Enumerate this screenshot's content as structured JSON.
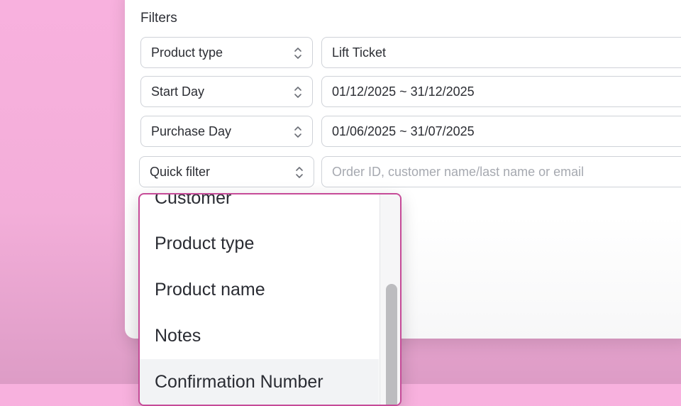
{
  "filters": {
    "title": "Filters",
    "rows": [
      {
        "select_label": "Product type",
        "value": "Lift Ticket",
        "placeholder": ""
      },
      {
        "select_label": "Start Day",
        "value": "01/12/2025 ~ 31/12/2025",
        "placeholder": ""
      },
      {
        "select_label": "Purchase Day",
        "value": "01/06/2025 ~ 31/07/2025",
        "placeholder": ""
      },
      {
        "select_label": "Quick filter",
        "value": "",
        "placeholder": "Order ID, customer name/last name or email"
      }
    ]
  },
  "dropdown": {
    "items": [
      "Customer",
      "Product type",
      "Product name",
      "Notes",
      "Confirmation Number"
    ],
    "highlighted_index": 4
  },
  "colors": {
    "accent_border": "#c64b98",
    "background_pink": "#f8b1de"
  },
  "icons": {
    "select_chevron": "chevron-up-down-icon"
  }
}
